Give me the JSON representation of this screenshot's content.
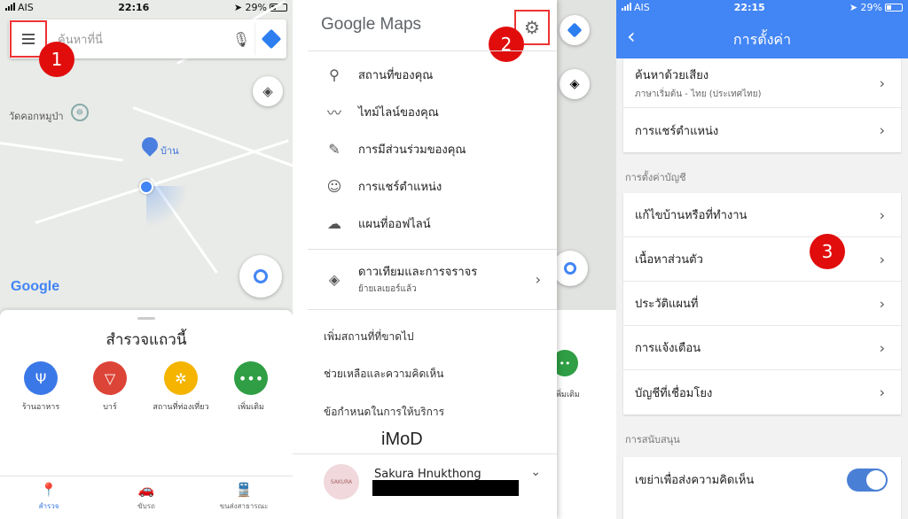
{
  "panel1": {
    "status": {
      "carrier": "AIS",
      "time": "22:16",
      "battery": "29%"
    },
    "search": {
      "placeholder": "ค้นหาที่นี่"
    },
    "badge": "1",
    "map_labels": {
      "temple": "วัดคอกหมูป่า",
      "home": "บ้าน"
    },
    "google_logo": "Google",
    "explore_title": "สำรวจแถวนี้",
    "categories": [
      {
        "label": "ร้านอาหาร",
        "color": "#3b78e7"
      },
      {
        "label": "บาร์",
        "color": "#dc4437"
      },
      {
        "label": "สถานที่ท่องเที่ยว",
        "color": "#f4b400"
      },
      {
        "label": "เพิ่มเติม",
        "color": "#2f9e44"
      }
    ],
    "nav": [
      "สำรวจ",
      "ขับรถ",
      "ขนส่งสาธารณะ"
    ]
  },
  "panel2": {
    "logo": "Google Maps",
    "badge": "2",
    "menu": [
      "สถานที่ของคุณ",
      "ไทม์ไลน์ของคุณ",
      "การมีส่วนร่วมของคุณ",
      "การแชร์ตำแหน่ง",
      "แผนที่ออฟไลน์"
    ],
    "layers": {
      "title": "ดาวเทียมและการจราจร",
      "subtitle": "ย้ายเลเยอร์แล้ว"
    },
    "links": [
      "เพิ่มสถานที่ที่ขาดไป",
      "ช่วยเหลือและความคิดเห็น",
      "ข้อกำหนดในการให้บริการ"
    ],
    "account": {
      "name": "Sakura Hnukthong",
      "avatar_text": "SAKURA"
    },
    "watermark": "iMoD",
    "strip_label": "เพิ่มเติม"
  },
  "panel3": {
    "status": {
      "carrier": "AIS",
      "time": "22:15",
      "battery": "29%"
    },
    "title": "การตั้งค่า",
    "voice": {
      "title": "ค้นหาด้วยเสียง",
      "subtitle": "ภาษาเริ่มต้น - ไทย (ประเทศไทย)"
    },
    "location_share": "การแชร์ตำแหน่ง",
    "account_section": "การตั้งค่าบัญชี",
    "account_items": [
      "แก้ไขบ้านหรือที่ทำงาน",
      "เนื้อหาส่วนตัว",
      "ประวัติแผนที่",
      "การแจ้งเตือน",
      "บัญชีที่เชื่อมโยง"
    ],
    "badge": "3",
    "support_section": "การสนับสนุน",
    "shake_feedback": "เขย่าเพื่อส่งความคิดเห็น"
  }
}
